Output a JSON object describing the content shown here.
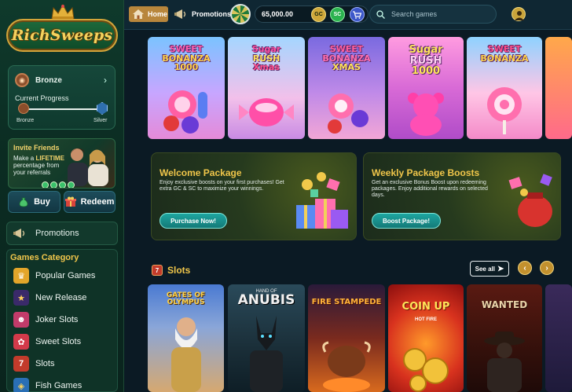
{
  "brand": {
    "name": "RichSweeps"
  },
  "tier": {
    "current": "Bronze",
    "progress_label": "Current Progress",
    "from": "Bronze",
    "to": "Silver"
  },
  "invite": {
    "title": "Invite Friends",
    "body_pre": "Make a ",
    "body_highlight": "LIFETIME",
    "body_post": " percentage from your referrals"
  },
  "sidebar": {
    "buy_label": "Buy",
    "redeem_label": "Redeem",
    "promotions_label": "Promotions",
    "games_category_title": "Games Category",
    "categories": [
      {
        "label": "Popular Games"
      },
      {
        "label": "New Release"
      },
      {
        "label": "Joker Slots"
      },
      {
        "label": "Sweet Slots"
      },
      {
        "label": "Slots"
      },
      {
        "label": "Fish Games"
      }
    ]
  },
  "topbar": {
    "home_label": "Home",
    "promotions_label": "Promotions",
    "balance": "65,000.00",
    "gc_label": "GC",
    "sc_label": "SC",
    "search_placeholder": "Search games"
  },
  "featured_games": [
    {
      "line1": "SWEET",
      "line2": "BONANZA",
      "line3": "1000"
    },
    {
      "line1": "Sugar",
      "line2": "RUSH",
      "line3": "Xmas"
    },
    {
      "line1": "SWEET",
      "line2": "BONANZA",
      "line3": "XMAS"
    },
    {
      "line1": "Sugar",
      "line2": "RUSH",
      "line3": "1000"
    },
    {
      "line1": "SWEET",
      "line2": "BONANZA",
      "line3": ""
    }
  ],
  "promos": {
    "welcome": {
      "title": "Welcome Package",
      "desc": "Enjoy exclusive boosts on your first purchases! Get extra GC & SC to maximize your winnings.",
      "cta": "Purchase Now!"
    },
    "weekly": {
      "title": "Weekly Package Boosts",
      "desc": "Get an exclusive Bonus Boost upon redeeming packages. Enjoy additional rewards on selected days.",
      "cta": "Boost Package!"
    }
  },
  "slots": {
    "title": "Slots",
    "see_all": "See all",
    "games": [
      {
        "title": "GATES OF OLYMPUS",
        "subtitle": ""
      },
      {
        "title": "ANUBIS",
        "subtitle": "HAND OF"
      },
      {
        "title": "FIRE STAMPEDE",
        "subtitle": ""
      },
      {
        "title": "COIN UP",
        "subtitle": "HOT FIRE"
      },
      {
        "title": "WANTED",
        "subtitle": ""
      }
    ]
  }
}
